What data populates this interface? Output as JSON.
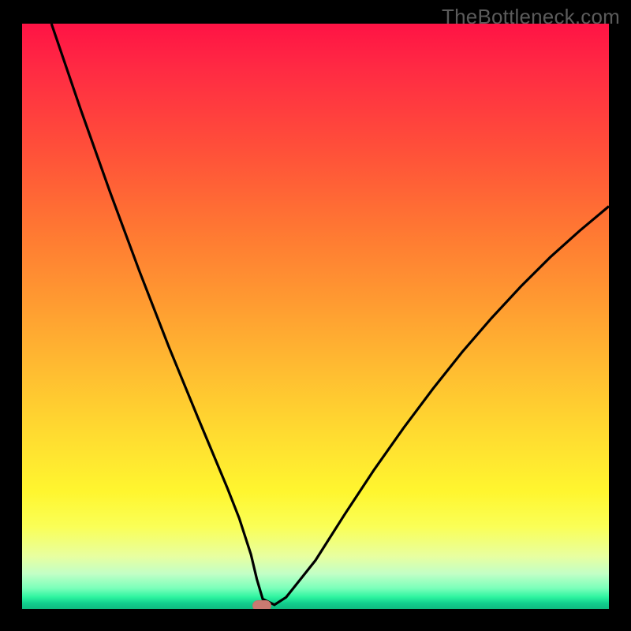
{
  "watermark": "TheBottleneck.com",
  "colors": {
    "background": "#000000",
    "curve": "#000000",
    "marker": "#c97a71"
  },
  "chart_data": {
    "type": "line",
    "title": "",
    "xlabel": "",
    "ylabel": "",
    "xlim": [
      0,
      100
    ],
    "ylim": [
      0,
      100
    ],
    "series": [
      {
        "name": "bottleneck-curve",
        "x": [
          5,
          10,
          15,
          20,
          25,
          30,
          35,
          37,
          39,
          40,
          41,
          43,
          45,
          50,
          55,
          60,
          65,
          70,
          75,
          80,
          85,
          90,
          95,
          100
        ],
        "y": [
          100,
          85.3,
          71.2,
          57.7,
          44.8,
          32.6,
          20.6,
          15.5,
          9.3,
          5.1,
          1.7,
          0.7,
          2.0,
          8.3,
          16.2,
          23.8,
          30.9,
          37.6,
          43.9,
          49.7,
          55.1,
          60.1,
          64.6,
          68.8
        ]
      }
    ],
    "marker": {
      "x": 40.9,
      "y": 0.6
    },
    "annotations": []
  }
}
